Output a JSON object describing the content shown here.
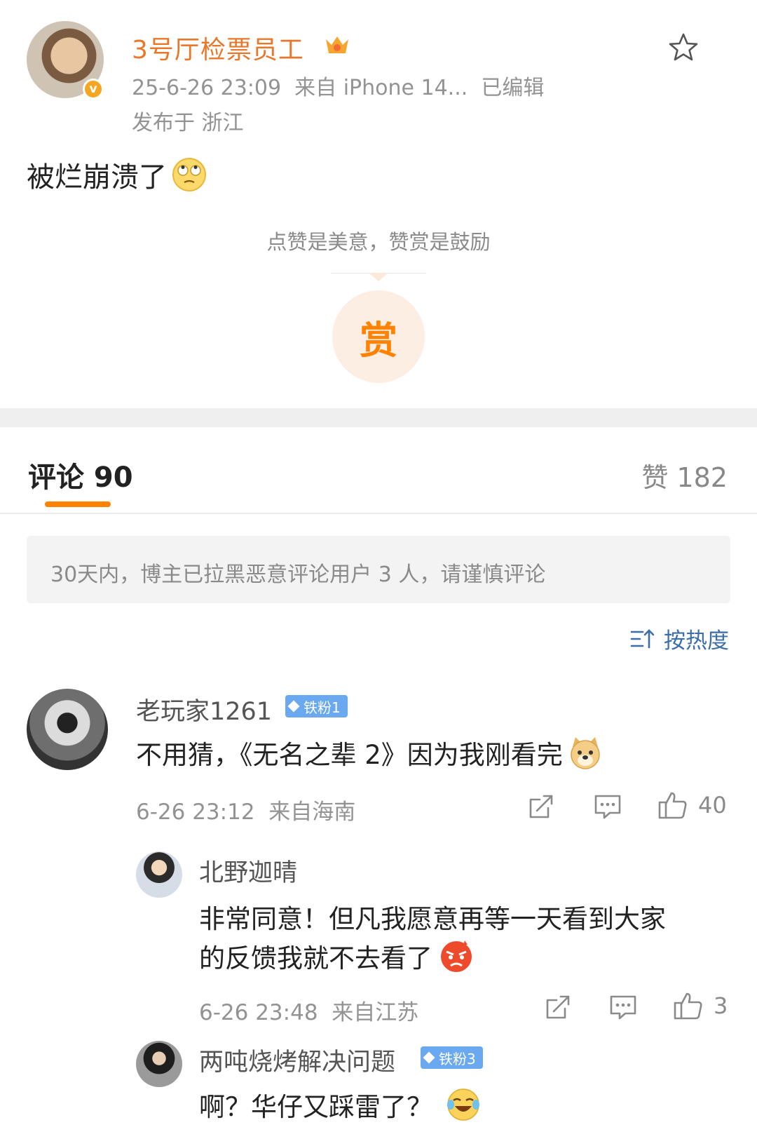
{
  "post": {
    "author": "3号厅检票员工",
    "meta_time": "25-6-26 23:09",
    "meta_source": "来自 iPhone 14...",
    "meta_edited": "已编辑",
    "location": "发布于 浙江",
    "text": "被烂崩溃了",
    "reward_hint": "点赞是美意，赞赏是鼓励",
    "reward_button": "赏"
  },
  "tabs": {
    "comments": "评论 90",
    "likes": "赞 182"
  },
  "notice": "30天内，博主已拉黑恶意评论用户 3 人，请谨慎评论",
  "sort_label": "按热度",
  "comments": [
    {
      "user": "老玩家1261",
      "badge": "铁粉1",
      "text": "不用猜，《无名之辈 2》因为我刚看完",
      "time": "6-26 23:12",
      "source": "来自海南",
      "likes": "40"
    }
  ],
  "replies": [
    {
      "user": "北野迦晴",
      "text_line1": "非常同意！但凡我愿意再等一天看到大家",
      "text_line2": "的反馈我就不去看了",
      "time": "6-26 23:48",
      "source": "来自江苏",
      "likes": "3"
    },
    {
      "user": "两吨烧烤解决问题",
      "badge": "铁粉3",
      "text": "啊？华仔又踩雷了？"
    }
  ],
  "colors": {
    "accent": "#ff8200",
    "author": "#e8772a",
    "badge_bg": "#6aa8f0"
  }
}
